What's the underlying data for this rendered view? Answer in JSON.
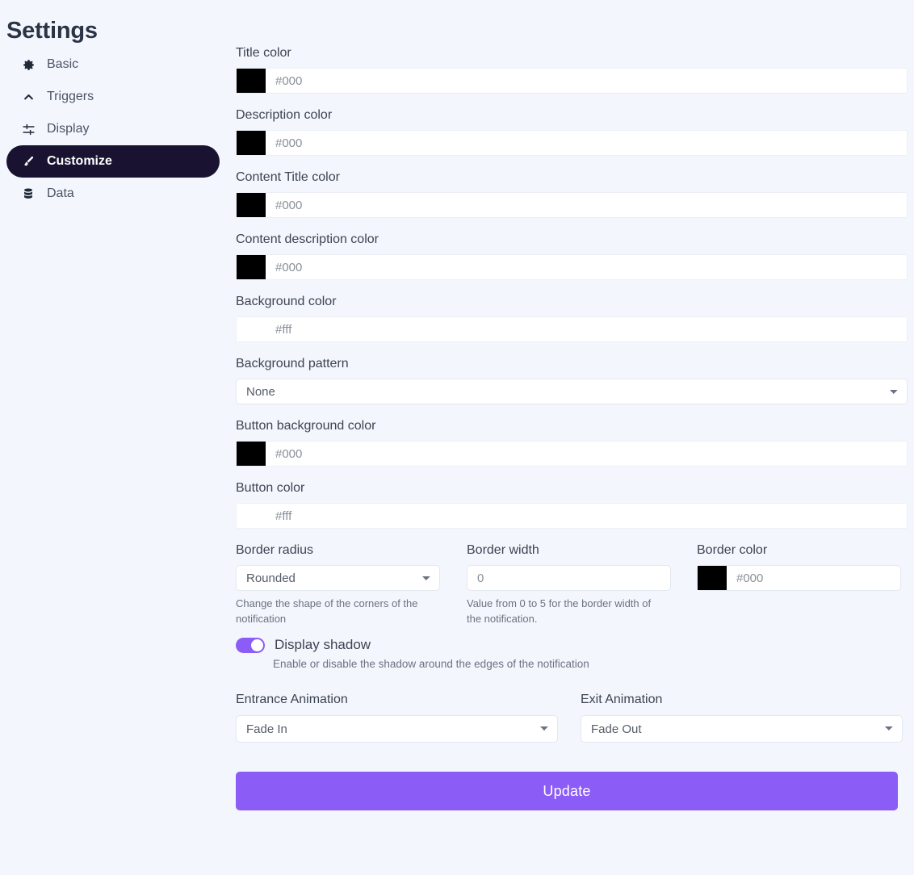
{
  "page": {
    "title": "Settings"
  },
  "sidebar": {
    "items": [
      {
        "label": "Basic",
        "icon": "gear-icon",
        "active": false
      },
      {
        "label": "Triggers",
        "icon": "chevron-up-icon",
        "active": false
      },
      {
        "label": "Display",
        "icon": "sliders-icon",
        "active": false
      },
      {
        "label": "Customize",
        "icon": "brush-icon",
        "active": true
      },
      {
        "label": "Data",
        "icon": "database-icon",
        "active": false
      }
    ]
  },
  "form": {
    "title_color": {
      "label": "Title color",
      "swatch": "#000000",
      "placeholder": "#000",
      "value": ""
    },
    "description_color": {
      "label": "Description color",
      "swatch": "#000000",
      "placeholder": "#000",
      "value": ""
    },
    "content_title_color": {
      "label": "Content Title color",
      "swatch": "#000000",
      "placeholder": "#000",
      "value": ""
    },
    "content_desc_color": {
      "label": "Content description color",
      "swatch": "#000000",
      "placeholder": "#000",
      "value": ""
    },
    "background_color": {
      "label": "Background color",
      "swatch": "#ffffff",
      "placeholder": "#fff",
      "value": ""
    },
    "background_pattern": {
      "label": "Background pattern",
      "selected": "None",
      "options": [
        "None"
      ]
    },
    "button_background_color": {
      "label": "Button background color",
      "swatch": "#000000",
      "placeholder": "#000",
      "value": ""
    },
    "button_color": {
      "label": "Button color",
      "swatch": "#ffffff",
      "placeholder": "#fff",
      "value": ""
    },
    "border_radius": {
      "label": "Border radius",
      "selected": "Rounded",
      "options": [
        "Rounded"
      ],
      "help": "Change the shape of the corners of the notification"
    },
    "border_width": {
      "label": "Border width",
      "value": "0",
      "placeholder": "0",
      "help": "Value from 0 to 5 for the border width of the notification."
    },
    "border_color": {
      "label": "Border color",
      "swatch": "#000000",
      "placeholder": "#000",
      "value": ""
    },
    "display_shadow": {
      "label": "Display shadow",
      "enabled": true,
      "help": "Enable or disable the shadow around the edges of the notification"
    },
    "entrance_animation": {
      "label": "Entrance Animation",
      "selected": "Fade In",
      "options": [
        "Fade In"
      ]
    },
    "exit_animation": {
      "label": "Exit Animation",
      "selected": "Fade Out",
      "options": [
        "Fade Out"
      ]
    },
    "update_button": {
      "label": "Update"
    }
  },
  "colors": {
    "accent_purple": "#8b5cf6",
    "sidebar_active_bg": "#191331",
    "page_background": "#f4f6fd",
    "heading": "#2b3445"
  }
}
